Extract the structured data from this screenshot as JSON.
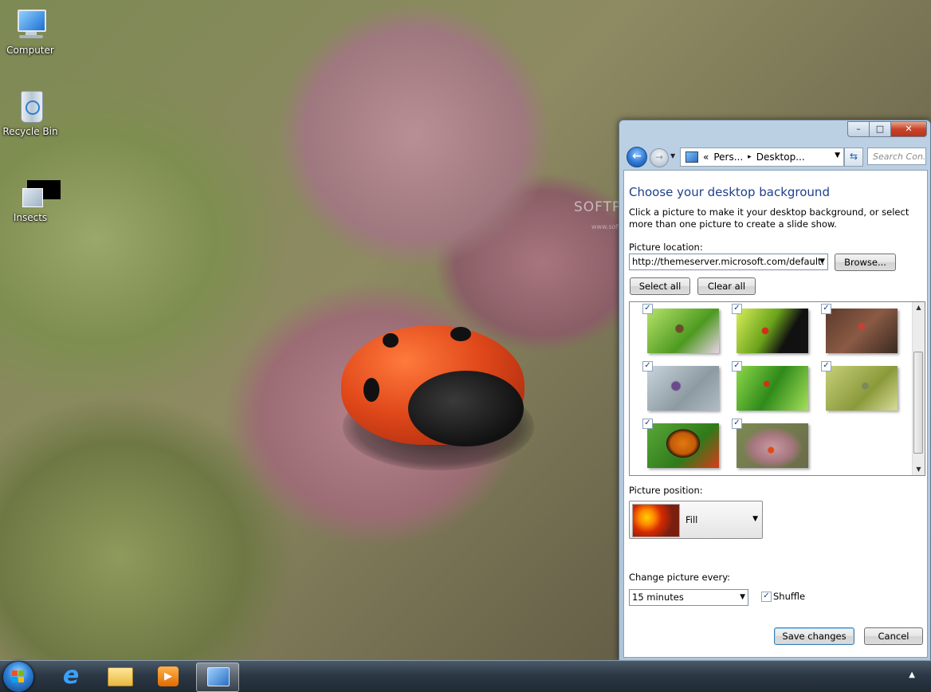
{
  "desktop": {
    "icons": [
      {
        "label": "Computer"
      },
      {
        "label": "Recycle Bin"
      },
      {
        "label": "Insects"
      }
    ],
    "watermark": "SOFTPEDIA",
    "watermark_url": "www.softpedia.com"
  },
  "taskbar": {
    "items": [
      "start-button",
      "internet-explorer",
      "windows-explorer",
      "media-player",
      "personalization-window"
    ],
    "tray_arrow": "▲"
  },
  "window": {
    "caption": {
      "minimize": "–",
      "maximize": "□",
      "close": "✕"
    },
    "nav": {
      "back": "←",
      "forward": "→"
    },
    "address": {
      "chevrons": "«",
      "crumb1": "Pers...",
      "sep": "▸",
      "crumb2": "Desktop...",
      "drop": "▼"
    },
    "search_placeholder": "Search Con...",
    "heading": "Choose your desktop background",
    "description": "Click a picture to make it your desktop background, or select more than one picture to create a slide show.",
    "picture_location": {
      "label": "Picture location:",
      "value": "http://themeserver.microsoft.com/default.",
      "browse": "Browse..."
    },
    "select_all": "Select all",
    "clear_all": "Clear all",
    "thumbnails": [
      {
        "checked": "✓",
        "name": "thumb-insect-on-leaf"
      },
      {
        "checked": "✓",
        "name": "thumb-spider-on-leaf"
      },
      {
        "checked": "✓",
        "name": "thumb-dragonfly-red"
      },
      {
        "checked": "✓",
        "name": "thumb-bee-on-flower"
      },
      {
        "checked": "✓",
        "name": "thumb-ladybug-on-grass"
      },
      {
        "checked": "✓",
        "name": "thumb-dragonfly-green"
      },
      {
        "checked": "✓",
        "name": "thumb-monarch-butterfly"
      },
      {
        "checked": "✓",
        "name": "thumb-ladybug-on-petal"
      }
    ],
    "picture_position": {
      "label": "Picture position:",
      "value": "Fill"
    },
    "change_every": {
      "label": "Change picture every:",
      "value": "15 minutes"
    },
    "shuffle": {
      "label": "Shuffle",
      "checked": "✓"
    },
    "save": "Save changes",
    "cancel": "Cancel"
  }
}
